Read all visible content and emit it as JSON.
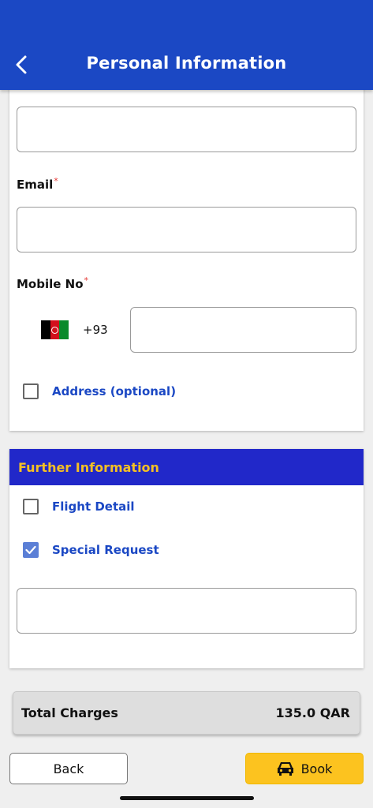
{
  "header": {
    "title": "Personal Information",
    "back_icon": "chevron-left-icon"
  },
  "form": {
    "name_value": "",
    "email_label": "Email",
    "email_value": "",
    "mobile_label": "Mobile No",
    "required_marker": "*",
    "country_flag": "afghanistan-flag-icon",
    "dial_code": "+93",
    "mobile_value": "",
    "address_label": "Address (optional)",
    "address_checked": false
  },
  "further": {
    "title": "Further Information",
    "flight_detail_label": "Flight Detail",
    "flight_detail_checked": false,
    "special_request_label": "Special Request",
    "special_request_checked": true,
    "special_request_value": ""
  },
  "summary": {
    "total_label": "Total Charges",
    "total_value": "135.0 QAR"
  },
  "actions": {
    "back_label": "Back",
    "book_label": "Book",
    "book_icon": "car-icon"
  },
  "colors": {
    "header_bg": "#1b48c4",
    "section_bg": "#2128c9",
    "section_title": "#f5c024",
    "link_blue": "#1b48c4",
    "book_button": "#fcc31f",
    "checkbox_checked": "#5b7fd6",
    "required": "#e53935"
  }
}
